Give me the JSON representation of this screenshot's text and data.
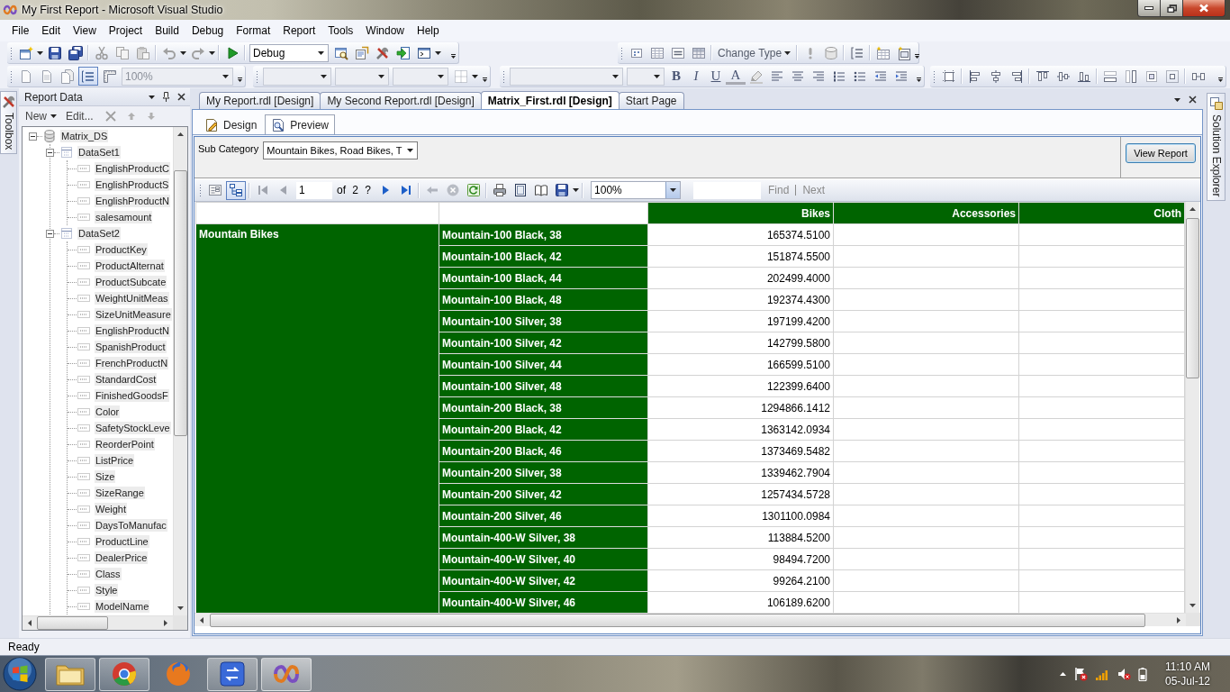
{
  "title_bar": {
    "title": "My First Report - Microsoft Visual Studio"
  },
  "menu": [
    "File",
    "Edit",
    "View",
    "Project",
    "Build",
    "Debug",
    "Format",
    "Report",
    "Tools",
    "Window",
    "Help"
  ],
  "standard_toolbar": {
    "configuration": "Debug"
  },
  "layout_toolbar": {
    "change_type": "Change Type"
  },
  "report_formatting_toolbar": {
    "zoom": {
      "value": "100%",
      "disabled": true
    },
    "grouping_on": true
  },
  "text_toolbar": {
    "buttons": [
      {
        "kind": "bold",
        "label": "B"
      },
      {
        "kind": "italic",
        "label": "I"
      },
      {
        "kind": "underline",
        "label": "U"
      },
      {
        "kind": "font_color",
        "label": "A"
      }
    ]
  },
  "toolbox": {
    "label": "Toolbox"
  },
  "report_data": {
    "title": "Report Data",
    "new_button": "New",
    "edit_button": "Edit...",
    "tree": [
      {
        "label": "Matrix_DS",
        "expanded": true,
        "children": [
          {
            "label": "DataSet1",
            "expanded": true,
            "children": [
              {
                "label": "EnglishProductC"
              },
              {
                "label": "EnglishProductS"
              },
              {
                "label": "EnglishProductN"
              },
              {
                "label": "salesamount"
              }
            ]
          },
          {
            "label": "DataSet2",
            "expanded": true,
            "children": [
              {
                "label": "ProductKey"
              },
              {
                "label": "ProductAlternat"
              },
              {
                "label": "ProductSubcate"
              },
              {
                "label": "WeightUnitMeas"
              },
              {
                "label": "SizeUnitMeasure"
              },
              {
                "label": "EnglishProductN"
              },
              {
                "label": "SpanishProduct"
              },
              {
                "label": "FrenchProductN"
              },
              {
                "label": "StandardCost"
              },
              {
                "label": "FinishedGoodsF"
              },
              {
                "label": "Color"
              },
              {
                "label": "SafetyStockLeve"
              },
              {
                "label": "ReorderPoint"
              },
              {
                "label": "ListPrice"
              },
              {
                "label": "Size"
              },
              {
                "label": "SizeRange"
              },
              {
                "label": "Weight"
              },
              {
                "label": "DaysToManufac"
              },
              {
                "label": "ProductLine"
              },
              {
                "label": "DealerPrice"
              },
              {
                "label": "Class"
              },
              {
                "label": "Style"
              },
              {
                "label": "ModelName"
              }
            ]
          }
        ]
      }
    ]
  },
  "document_tabs": [
    {
      "label": "My Report.rdl [Design]",
      "selected": false
    },
    {
      "label": "My Second Report.rdl [Design]",
      "selected": false
    },
    {
      "label": "Matrix_First.rdl [Design]",
      "selected": true
    },
    {
      "label": "Start Page",
      "selected": false
    }
  ],
  "view_tabs": [
    {
      "label": "Design",
      "selected": false
    },
    {
      "label": "Preview",
      "selected": true
    }
  ],
  "parameters": [
    {
      "label": "Sub Category",
      "value": "Mountain Bikes, Road Bikes, T"
    }
  ],
  "view_report_button": "View Report",
  "report_toolbar": {
    "document_map_on": true,
    "page": "1",
    "page_count": "of 2 ?",
    "zoom": "100%",
    "find_link": {
      "label": "Find",
      "disabled": true
    },
    "next_link": {
      "label": "Next",
      "disabled": true
    }
  },
  "matrix": {
    "columns": [
      "Bikes",
      "Accessories",
      "Cloth"
    ],
    "groups": [
      {
        "label": "Mountain Bikes",
        "rows": [
          {
            "label": "Mountain-100 Black, 38",
            "values": [
              "165374.5100"
            ]
          },
          {
            "label": "Mountain-100 Black, 42",
            "values": [
              "151874.5500"
            ]
          },
          {
            "label": "Mountain-100 Black, 44",
            "values": [
              "202499.4000"
            ]
          },
          {
            "label": "Mountain-100 Black, 48",
            "values": [
              "192374.4300"
            ]
          },
          {
            "label": "Mountain-100 Silver, 38",
            "values": [
              "197199.4200"
            ]
          },
          {
            "label": "Mountain-100 Silver, 42",
            "values": [
              "142799.5800"
            ]
          },
          {
            "label": "Mountain-100 Silver, 44",
            "values": [
              "166599.5100"
            ]
          },
          {
            "label": "Mountain-100 Silver, 48",
            "values": [
              "122399.6400"
            ]
          },
          {
            "label": "Mountain-200 Black, 38",
            "values": [
              "1294866.1412"
            ]
          },
          {
            "label": "Mountain-200 Black, 42",
            "values": [
              "1363142.0934"
            ]
          },
          {
            "label": "Mountain-200 Black, 46",
            "values": [
              "1373469.5482"
            ]
          },
          {
            "label": "Mountain-200 Silver, 38",
            "values": [
              "1339462.7904"
            ]
          },
          {
            "label": "Mountain-200 Silver, 42",
            "values": [
              "1257434.5728"
            ]
          },
          {
            "label": "Mountain-200 Silver, 46",
            "values": [
              "1301100.0984"
            ]
          },
          {
            "label": "Mountain-400-W Silver, 38",
            "values": [
              "113884.5200"
            ]
          },
          {
            "label": "Mountain-400-W Silver, 40",
            "values": [
              "98494.7200"
            ]
          },
          {
            "label": "Mountain-400-W Silver, 42",
            "values": [
              "99264.2100"
            ]
          },
          {
            "label": "Mountain-400-W Silver, 46",
            "values": [
              "106189.6200"
            ]
          }
        ]
      }
    ]
  },
  "solution_explorer": {
    "label": "Solution Explorer"
  },
  "status_bar": {
    "text": "Ready"
  },
  "taskbar": {
    "time": "11:10 AM",
    "date": "05-Jul-12"
  }
}
